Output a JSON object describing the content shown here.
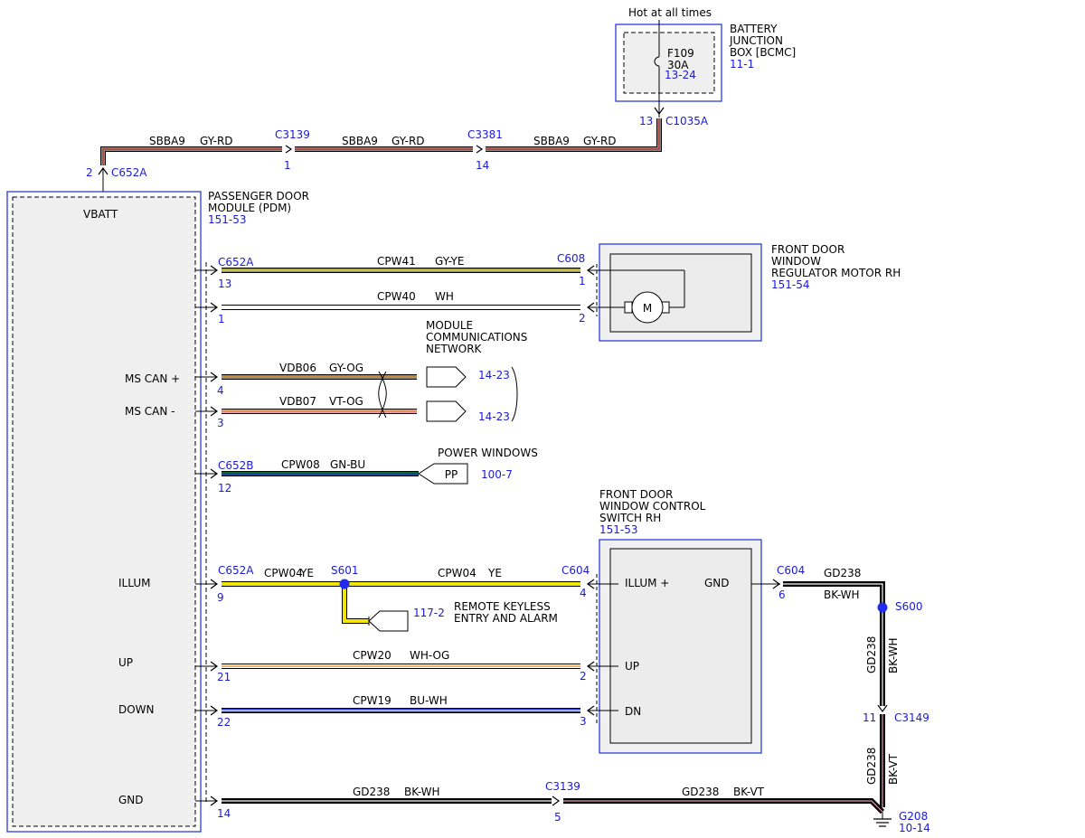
{
  "battery": {
    "hot_label": "Hot at all times",
    "name_line1": "BATTERY",
    "name_line2": "JUNCTION",
    "name_line3": "BOX [BCMC]",
    "ref": "11-1",
    "fuse_id": "F109",
    "fuse_rating": "30A",
    "fuse_ref": "13-24",
    "pin": "13",
    "connector": "C1035A"
  },
  "top_feed": {
    "seg1_circuit": "SBBA9",
    "seg1_color": "GY-RD",
    "seg2_circuit": "SBBA9",
    "seg2_color": "GY-RD",
    "seg3_circuit": "SBBA9",
    "seg3_color": "GY-RD",
    "c3139_name": "C3139",
    "c3139_pin": "1",
    "c3381_name": "C3381",
    "c3381_pin": "14",
    "pdm_pin": "2",
    "pdm_connector": "C652A"
  },
  "pdm": {
    "name_line1": "PASSENGER DOOR",
    "name_line2": "MODULE (PDM)",
    "ref": "151-53",
    "vbatt": "VBATT",
    "ms_can_plus": "MS CAN +",
    "ms_can_minus": "MS CAN -",
    "illum": "ILLUM",
    "up": "UP",
    "down": "DOWN",
    "gnd": "GND"
  },
  "motor": {
    "name_line1": "FRONT DOOR",
    "name_line2": "WINDOW",
    "name_line3": "REGULATOR MOTOR RH",
    "ref": "151-54",
    "symbol": "M"
  },
  "wire_cpw41": {
    "conn": "C652A",
    "pin": "13",
    "circuit": "CPW41",
    "color": "GY-YE",
    "far_conn": "C608",
    "far_pin": "1"
  },
  "wire_cpw40": {
    "pin": "1",
    "circuit": "CPW40",
    "color": "WH",
    "far_pin": "2"
  },
  "network": {
    "line1": "MODULE",
    "line2": "COMMUNICATIONS",
    "line3": "NETWORK",
    "can_plus": {
      "pin": "4",
      "circuit": "VDB06",
      "color": "GY-OG",
      "ref": "14-23"
    },
    "can_minus": {
      "pin": "3",
      "circuit": "VDB07",
      "color": "VT-OG",
      "ref": "14-23"
    }
  },
  "power_windows": {
    "title": "POWER WINDOWS",
    "conn": "C652B",
    "pin": "12",
    "circuit": "CPW08",
    "color": "GN-BU",
    "symbol": "PP",
    "ref": "100-7"
  },
  "switch": {
    "name_line1": "FRONT DOOR",
    "name_line2": "WINDOW CONTROL",
    "name_line3": "SWITCH RH",
    "ref": "151-53",
    "illum_plus": "ILLUM +",
    "gnd": "GND",
    "up": "UP",
    "dn": "DN"
  },
  "illum_wire": {
    "conn": "C652A",
    "pin": "9",
    "seg1_circuit": "CPW04",
    "seg1_color": "YE",
    "splice": "S601",
    "seg2_circuit": "CPW04",
    "seg2_color": "YE",
    "far_conn": "C604",
    "far_pin": "4",
    "rke_ref": "117-2",
    "rke_line1": "REMOTE KEYLESS",
    "rke_line2": "ENTRY AND ALARM"
  },
  "up_wire": {
    "pin": "21",
    "circuit": "CPW20",
    "color": "WH-OG",
    "far_pin": "2"
  },
  "down_wire": {
    "pin": "22",
    "circuit": "CPW19",
    "color": "BU-WH",
    "far_pin": "3"
  },
  "ground": {
    "c604": "C604",
    "c604_pin": "6",
    "seg1_circuit": "GD238",
    "seg1_color": "BK-WH",
    "splice": "S600",
    "vert1_circuit": "GD238",
    "vert1_color": "BK-WH",
    "c3149": "C3149",
    "c3149_pin": "11",
    "vert2_circuit": "GD238",
    "vert2_color": "BK-VT",
    "ground_id": "G208",
    "ground_ref": "10-14",
    "pdm_pin": "14",
    "bottom1_circuit": "GD238",
    "bottom1_color": "BK-WH",
    "c3139": "C3139",
    "c3139_pin": "5",
    "bottom2_circuit": "GD238",
    "bottom2_color": "BK-VT"
  },
  "wire_colors": {
    "gray": "#8a8a8a",
    "red": "#c0392b",
    "yellow": "#f2e600",
    "white": "#ffffff",
    "orange": "#e8890c",
    "violet": "#e89abf",
    "green": "#0e6b2e",
    "blue": "#1d2ee0",
    "black": "#000000",
    "splice": "#1f2bf0"
  }
}
